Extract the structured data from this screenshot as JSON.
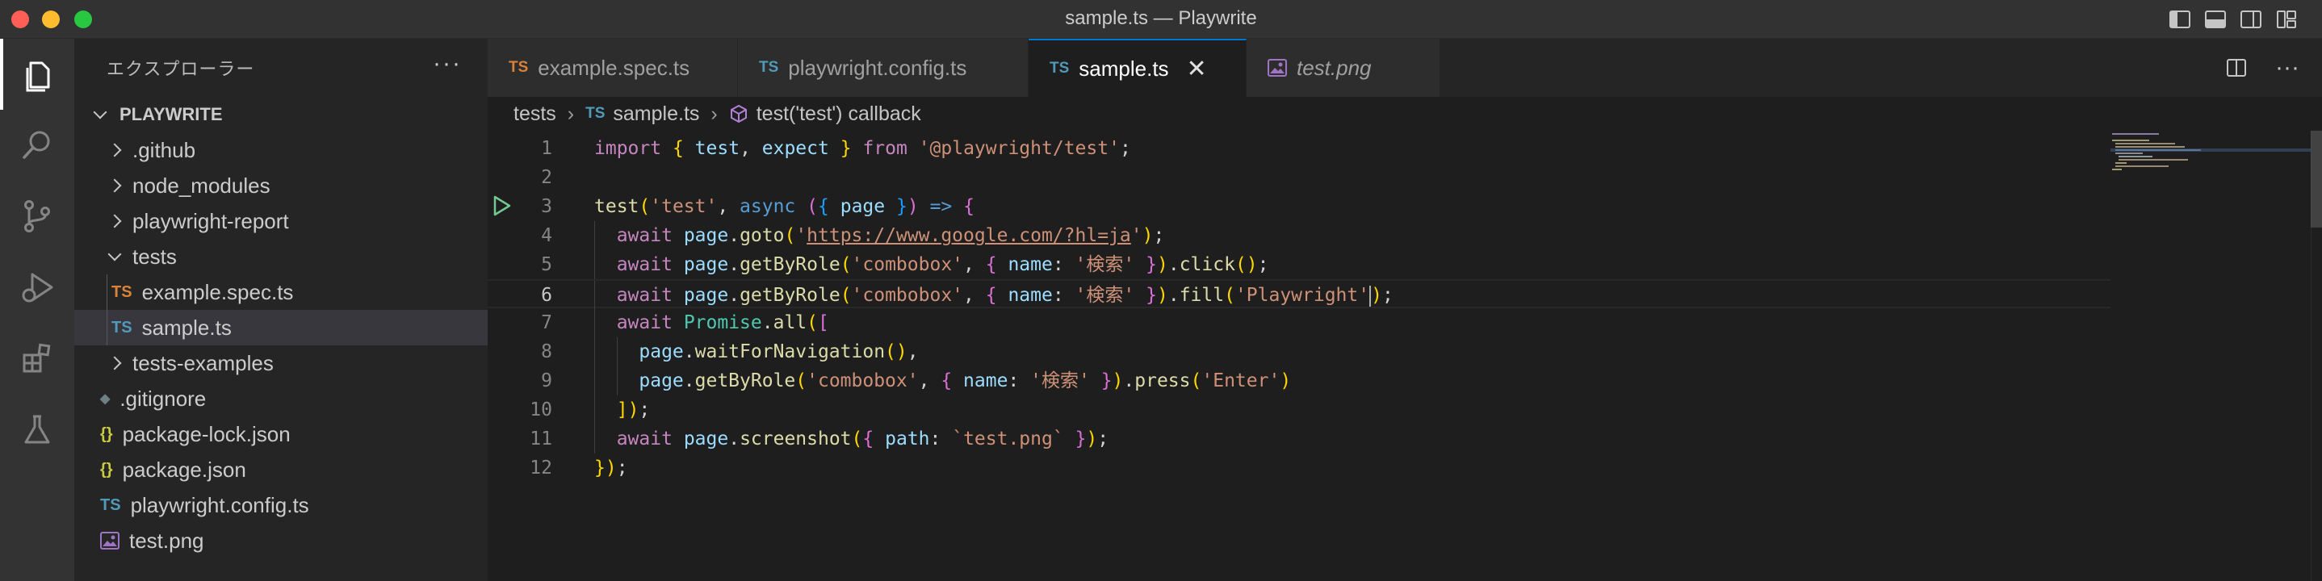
{
  "window": {
    "title": "sample.ts — Playwrite"
  },
  "activity_bar": [
    {
      "icon": "files-icon",
      "active": true
    },
    {
      "icon": "search-icon"
    },
    {
      "icon": "source-control-icon"
    },
    {
      "icon": "run-debug-icon"
    },
    {
      "icon": "extensions-icon"
    },
    {
      "icon": "testing-icon"
    }
  ],
  "sidebar": {
    "header": "エクスプローラー",
    "more": "···",
    "folder": "PLAYWRITE",
    "items": [
      {
        "label": ".github",
        "type": "folder",
        "expanded": false,
        "depth": 1
      },
      {
        "label": "node_modules",
        "type": "folder",
        "expanded": false,
        "depth": 1
      },
      {
        "label": "playwright-report",
        "type": "folder",
        "expanded": false,
        "depth": 1
      },
      {
        "label": "tests",
        "type": "folder",
        "expanded": true,
        "depth": 1
      },
      {
        "label": "example.spec.ts",
        "type": "file",
        "icon": "TS",
        "iconColor": "#d9823a",
        "depth": 2
      },
      {
        "label": "sample.ts",
        "type": "file",
        "icon": "TS",
        "iconColor": "#519aba",
        "depth": 2,
        "selected": true
      },
      {
        "label": "tests-examples",
        "type": "folder",
        "expanded": false,
        "depth": 1
      },
      {
        "label": ".gitignore",
        "type": "file",
        "icon": "◆",
        "iconColor": "#41535b",
        "depth": 1
      },
      {
        "label": "package-lock.json",
        "type": "file",
        "icon": "{}",
        "iconColor": "#cbcb41",
        "depth": 1
      },
      {
        "label": "package.json",
        "type": "file",
        "icon": "{}",
        "iconColor": "#cbcb41",
        "depth": 1
      },
      {
        "label": "playwright.config.ts",
        "type": "file",
        "icon": "TS",
        "iconColor": "#519aba",
        "depth": 1
      },
      {
        "label": "test.png",
        "type": "file",
        "icon": "image",
        "iconColor": "#a074c4",
        "depth": 1
      }
    ]
  },
  "tabs": [
    {
      "label": "example.spec.ts",
      "icon": "TS",
      "iconColor": "#d9823a",
      "active": false
    },
    {
      "label": "playwright.config.ts",
      "icon": "TS",
      "iconColor": "#519aba",
      "active": false
    },
    {
      "label": "sample.ts",
      "icon": "TS",
      "iconColor": "#519aba",
      "active": true,
      "close": "✕"
    },
    {
      "label": "test.png",
      "icon": "image",
      "iconColor": "#a074c4",
      "active": false,
      "italic": true
    }
  ],
  "breadcrumb": {
    "folder": "tests",
    "file": "sample.ts",
    "file_icon": "TS",
    "symbol": "test('test') callback"
  },
  "editor": {
    "current_line": 6,
    "lines": [
      {
        "n": "1",
        "text": "import { test, expect } from '@playwright/test';"
      },
      {
        "n": "2",
        "text": ""
      },
      {
        "n": "3",
        "text": "test('test', async ({ page }) => {"
      },
      {
        "n": "4",
        "text": "  await page.goto('https://www.google.com/?hl=ja');"
      },
      {
        "n": "5",
        "text": "  await page.getByRole('combobox', { name: '検索' }).click();"
      },
      {
        "n": "6",
        "text": "  await page.getByRole('combobox', { name: '検索' }).fill('Playwright');"
      },
      {
        "n": "7",
        "text": "  await Promise.all(["
      },
      {
        "n": "8",
        "text": "    page.waitForNavigation(),"
      },
      {
        "n": "9",
        "text": "    page.getByRole('combobox', { name: '検索' }).press('Enter')"
      },
      {
        "n": "10",
        "text": "  ]);"
      },
      {
        "n": "11",
        "text": "  await page.screenshot({ path: `test.png` });"
      },
      {
        "n": "12",
        "text": "});"
      }
    ]
  },
  "colors": {
    "accent": "#007acc",
    "keyword": "#c586c0",
    "function": "#dcdcaa",
    "variable": "#9cdcfe",
    "string": "#ce9178",
    "run_icon": "#73c991"
  }
}
